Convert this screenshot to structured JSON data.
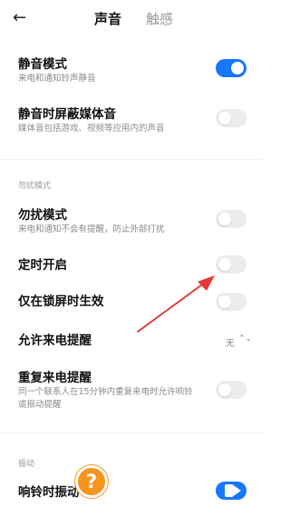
{
  "header": {
    "back_icon": "arrow-left-icon",
    "tabs": [
      "声音",
      "触感"
    ]
  },
  "settings": {
    "silent_mode": {
      "title": "静音模式",
      "subtitle": "来电和通知铃声静音",
      "on": true
    },
    "mute_media": {
      "title": "静音时屏蔽媒体音",
      "subtitle": "媒体音包括游戏、视频等应用内的声音",
      "on": false
    }
  },
  "dnd": {
    "section_label": "勿扰模式",
    "dnd_mode": {
      "title": "勿扰模式",
      "subtitle": "来电和通知不会有提醒，防止外部打扰",
      "on": false
    },
    "scheduled": {
      "title": "定时开启",
      "on": false
    },
    "lockscreen_only": {
      "title": "仅在锁屏时生效",
      "on": false
    },
    "allow_calls": {
      "title": "允许来电提醒",
      "value": "无"
    },
    "repeat_calls": {
      "title": "重复来电提醒",
      "subtitle_lines": [
        "同一个联系人在15分钟内重复来电时允许响铃",
        "或振动提醒"
      ],
      "on": false
    }
  },
  "vibration": {
    "section_label": "振动",
    "ring_vibrate": {
      "title": "响铃时振动",
      "on": true
    }
  },
  "colors": {
    "accent": "#1677ff",
    "annotation": "#e53935",
    "help_badge": "#f7941d"
  },
  "help_badge": "?"
}
